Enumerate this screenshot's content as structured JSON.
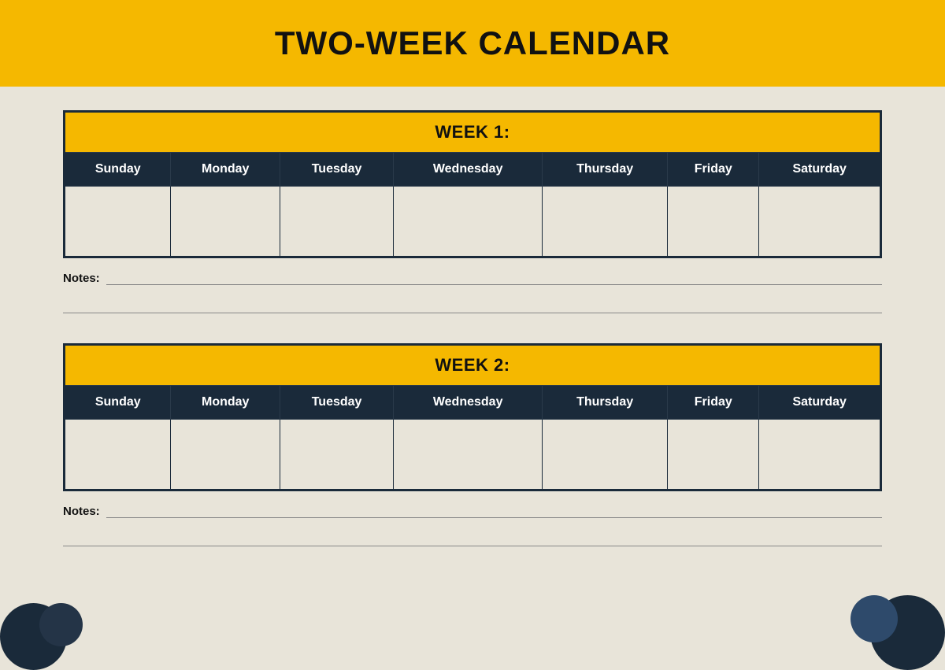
{
  "header": {
    "title": "TWO-WEEK CALENDAR"
  },
  "week1": {
    "label": "WEEK 1:",
    "days": [
      "Sunday",
      "Monday",
      "Tuesday",
      "Wednesday",
      "Thursday",
      "Friday",
      "Saturday"
    ],
    "notes_label": "Notes:"
  },
  "week2": {
    "label": "WEEK 2:",
    "days": [
      "Sunday",
      "Monday",
      "Tuesday",
      "Wednesday",
      "Thursday",
      "Friday",
      "Saturday"
    ],
    "notes_label": "Notes:"
  },
  "colors": {
    "header_bg": "#f5b800",
    "table_header_day_bg": "#1a2a3a",
    "page_bg": "#e8e4d9",
    "title_color": "#111111"
  }
}
